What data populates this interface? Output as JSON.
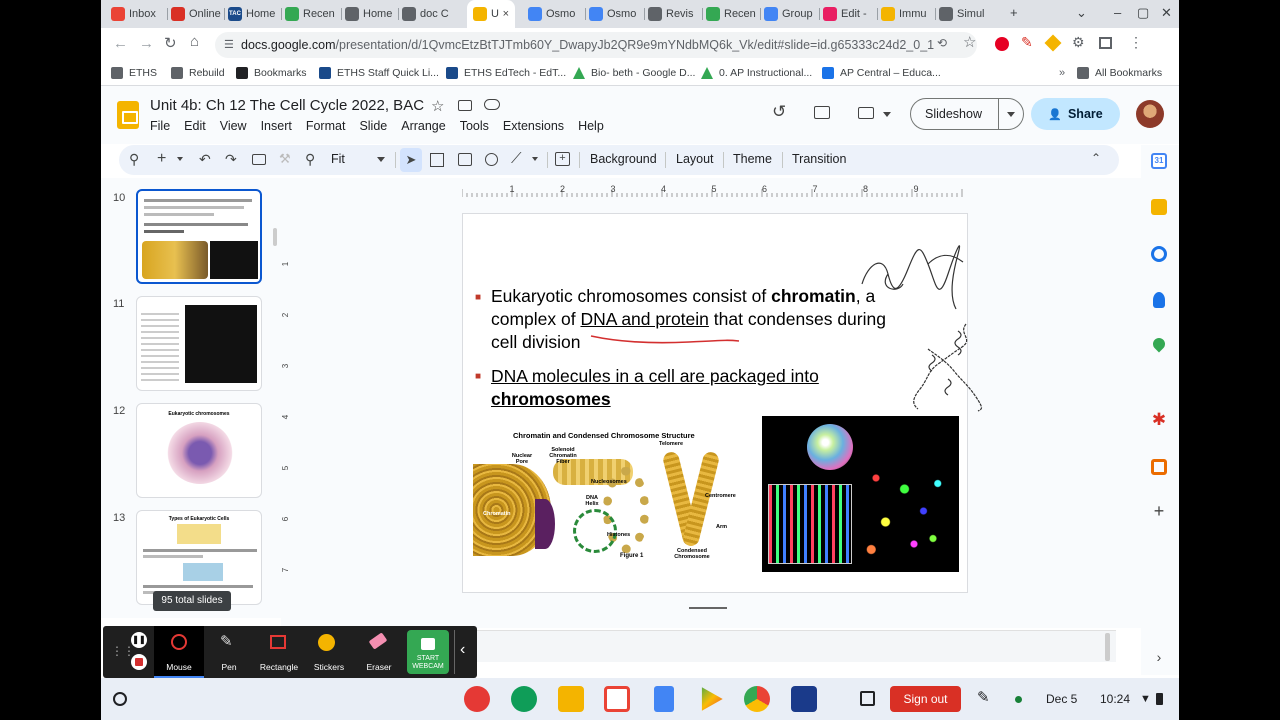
{
  "browser": {
    "tabs": [
      {
        "title": "Inbox",
        "favicon": "gmail-icon",
        "color": "#ea4335"
      },
      {
        "title": "Online",
        "favicon": "doc-icon",
        "color": "#d93025"
      },
      {
        "title": "Home",
        "favicon": "tac-icon",
        "color": "#1a4a8a",
        "badge": "TAC"
      },
      {
        "title": "Recen",
        "favicon": "drive-icon",
        "color": "#34a853"
      },
      {
        "title": "Home",
        "favicon": "globe-icon",
        "color": "#5f6368"
      },
      {
        "title": "doc C",
        "favicon": "globe-icon",
        "color": "#5f6368"
      },
      {
        "title": "U",
        "favicon": "slides-icon",
        "color": "#f4b400",
        "active": true
      },
      {
        "title": "Osmo",
        "favicon": "docs-icon",
        "color": "#4285f4"
      },
      {
        "title": "Osmo",
        "favicon": "docs-icon",
        "color": "#4285f4"
      },
      {
        "title": "Revis",
        "favicon": "globe-icon",
        "color": "#5f6368"
      },
      {
        "title": "Recen",
        "favicon": "drive-icon",
        "color": "#34a853"
      },
      {
        "title": "Group",
        "favicon": "sheets-icon",
        "color": "#4285f4"
      },
      {
        "title": "Edit -",
        "favicon": "edit-icon",
        "color": "#e91e63"
      },
      {
        "title": "Immu",
        "favicon": "slides-icon",
        "color": "#f4b400"
      },
      {
        "title": "Simul",
        "favicon": "globe-icon",
        "color": "#5f6368"
      }
    ],
    "url_host": "docs.google.com",
    "url_path": "/presentation/d/1QvmcEtzBtTJTmb60Y_DwapyJb2QR9e9mYNdbMQ6k_Vk/edit#slide=id.g65333c24d2_0_1",
    "bookmarks": [
      {
        "label": "ETHS",
        "icon": "folder-icon"
      },
      {
        "label": "Rebuild",
        "icon": "folder-icon"
      },
      {
        "label": "Bookmarks",
        "icon": "star-icon"
      },
      {
        "label": "ETHS Staff Quick Li...",
        "icon": "bookmark-page-icon"
      },
      {
        "label": "ETHS EdTech - EdT...",
        "icon": "bookmark-page-icon"
      },
      {
        "label": "Bio- beth - Google D...",
        "icon": "drive-icon"
      },
      {
        "label": "0. AP Instructional...",
        "icon": "drive-icon"
      },
      {
        "label": "AP Central – Educa...",
        "icon": "shield-icon"
      }
    ],
    "all_bookmarks": "All Bookmarks"
  },
  "slides_app": {
    "title": "Unit 4b:  Ch 12 The Cell Cycle 2022, BAC",
    "menu": [
      "File",
      "Edit",
      "View",
      "Insert",
      "Format",
      "Slide",
      "Arrange",
      "Tools",
      "Extensions",
      "Help"
    ],
    "slideshow_label": "Slideshow",
    "share_label": "Share",
    "zoom": "Fit",
    "toolbar_labels": {
      "background": "Background",
      "layout": "Layout",
      "theme": "Theme",
      "transition": "Transition"
    },
    "total_slides": "95 total slides",
    "thumbnails": [
      {
        "number": "10",
        "selected": true
      },
      {
        "number": "11",
        "selected": false
      },
      {
        "number": "12",
        "selected": false,
        "title": "Eukaryotic chromosomes"
      },
      {
        "number": "13",
        "selected": false,
        "title": "Types of Eukaryotic Cells"
      }
    ],
    "ruler_h": [
      "1",
      "2",
      "3",
      "4",
      "5",
      "6",
      "7",
      "8",
      "9"
    ],
    "ruler_v": [
      "1",
      "2",
      "3",
      "4",
      "5",
      "6",
      "7"
    ]
  },
  "slide": {
    "bullet1_part1": "Eukaryotic chromosomes consist of ",
    "bullet1_bold": "chromatin",
    "bullet1_part2": ", a",
    "bullet1_line2_a": "complex of ",
    "bullet1_line2_u": "DNA and protein",
    "bullet1_line2_b": " that condenses during",
    "bullet1_line3": "cell division",
    "bullet2_line1": "DNA molecules in a cell are packaged into",
    "bullet2_line2": "chromosomes",
    "figure_title": "Chromatin and Condensed Chromosome Structure",
    "figure_labels": {
      "nuclear_pore": "Nuclear Pore",
      "solenoid": "Solenoid Chromatin Fiber",
      "telomere": "Telomere",
      "nucleosomes": "Nucleosomes",
      "dna_helix": "DNA Helix",
      "centromere": "Centromere",
      "chromatin": "Chromatin",
      "arm": "Arm",
      "histones": "Histones",
      "figure1": "Figure 1",
      "condensed": "Condensed Chromosome"
    },
    "colors": {
      "bullet": "#c0392b",
      "annotation": "#d32f2f"
    }
  },
  "screencast": {
    "tools": [
      "Mouse",
      "Pen",
      "Rectangle",
      "Stickers",
      "Eraser"
    ],
    "webcam_label": "START WEBCAM"
  },
  "shelf": {
    "signout": "Sign out",
    "date": "Dec 5",
    "time": "10:24"
  }
}
